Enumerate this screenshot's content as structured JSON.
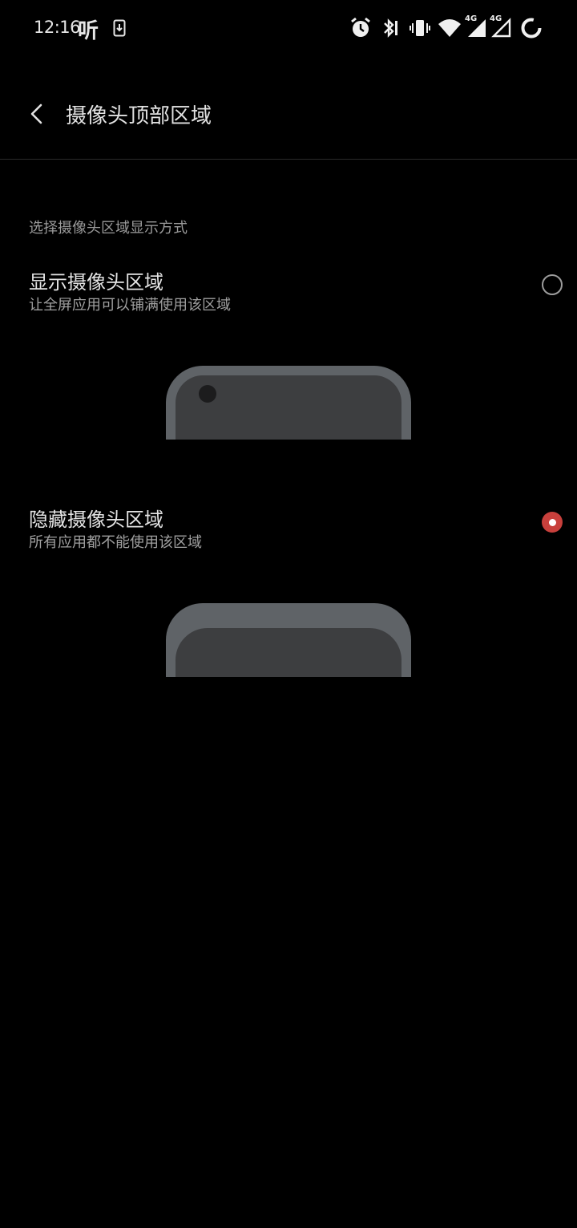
{
  "status_bar": {
    "time": "12:16",
    "app_glyph": "听",
    "icons": [
      "download-icon",
      "alarm-icon",
      "bluetooth-icon",
      "vibrate-icon",
      "wifi-icon",
      "signal-4g-icon",
      "signal-4g-icon-2",
      "battery-ring-icon"
    ],
    "network_label_1": "4G",
    "network_label_2": "4G"
  },
  "header": {
    "title": "摄像头顶部区域",
    "back_icon": "chevron-left-icon"
  },
  "section": {
    "label": "选择摄像头区域显示方式"
  },
  "options": [
    {
      "title": "显示摄像头区域",
      "subtitle": "让全屏应用可以铺满使用该区域",
      "selected": false
    },
    {
      "title": "隐藏摄像头区域",
      "subtitle": "所有应用都不能使用该区域",
      "selected": true
    }
  ],
  "colors": {
    "background": "#000000",
    "accent": "#c8403c",
    "phone_frame": "#5f6367",
    "phone_screen": "#3d3e40"
  }
}
